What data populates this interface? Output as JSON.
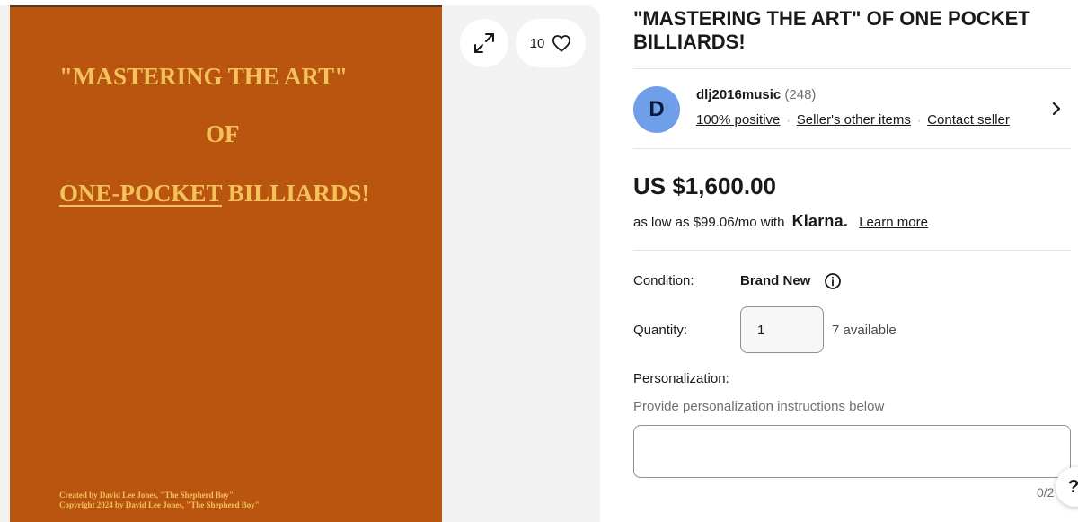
{
  "gallery": {
    "cover": {
      "line1": "\"MASTERING THE ART\"",
      "line2": "OF",
      "line3_underlined": "ONE-POCKET",
      "line3_rest": " BILLIARDS!",
      "credit1": "Created by David Lee Jones, \"The Shepherd Boy\"",
      "credit2": "Copyright 2024 by David Lee Jones, \"The Shepherd Boy\""
    },
    "expand_icon": "expand-icon",
    "watch_count": "10",
    "heart_icon": "heart-icon"
  },
  "listing": {
    "title": "\"MASTERING THE ART\" OF ONE POCKET BILLIARDS!"
  },
  "seller": {
    "avatar_letter": "D",
    "name": "dlj2016music",
    "score": "(248)",
    "positive": "100% positive",
    "other_items": "Seller's other items",
    "contact": "Contact seller",
    "separator": "·"
  },
  "price": {
    "amount": "US $1,600.00",
    "finance_prefix": "as low as $99.06/mo with",
    "finance_brand": "Klarna.",
    "learn_more": "Learn more"
  },
  "condition": {
    "label": "Condition:",
    "value": "Brand New"
  },
  "quantity": {
    "label": "Quantity:",
    "value": "1",
    "available": "7 available"
  },
  "personalization": {
    "label": "Personalization:",
    "help": "Provide personalization instructions below",
    "value": "",
    "counter": "0/2"
  },
  "help_button": "?",
  "colors": {
    "cover_bg": "#b9550f",
    "cover_text": "#f3c25a",
    "avatar_bg": "#6f9fe8",
    "gallery_bg": "#f2f2f2"
  }
}
